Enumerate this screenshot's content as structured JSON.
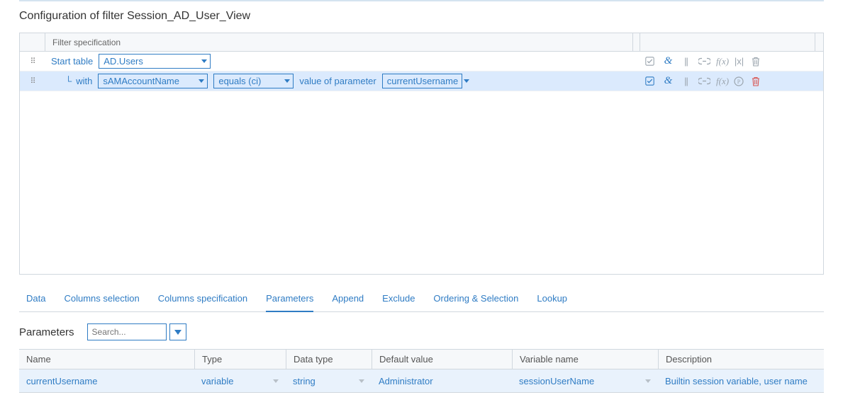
{
  "page_title": "Configuration of filter Session_AD_User_View",
  "filter_header_label": "Filter specification",
  "row1": {
    "start_label": "Start table",
    "table_value": "AD.Users"
  },
  "row2": {
    "with_label": "with",
    "field_value": "sAMAccountName",
    "op_value": "equals (ci)",
    "vop_label": "value of parameter",
    "param_value": "currentUsername"
  },
  "icon_labels": {
    "check": "check-icon",
    "amp": "&",
    "pipes": "||",
    "link": "link-icon",
    "fx": "f(x)",
    "abs": "|x|",
    "p": "P",
    "trash": "trash-icon"
  },
  "tabs": {
    "data": "Data",
    "cols_sel": "Columns selection",
    "cols_spec": "Columns specification",
    "params": "Parameters",
    "append": "Append",
    "exclude": "Exclude",
    "ordering": "Ordering & Selection",
    "lookup": "Lookup"
  },
  "params_section": {
    "title": "Parameters",
    "search_placeholder": "Search..."
  },
  "param_table": {
    "headers": {
      "name": "Name",
      "type": "Type",
      "dtype": "Data type",
      "default": "Default value",
      "var": "Variable name",
      "desc": "Description"
    },
    "rows": [
      {
        "name": "currentUsername",
        "type": "variable",
        "dtype": "string",
        "default": "Administrator",
        "var": "sessionUserName",
        "desc": "Builtin session variable, user name"
      }
    ]
  }
}
